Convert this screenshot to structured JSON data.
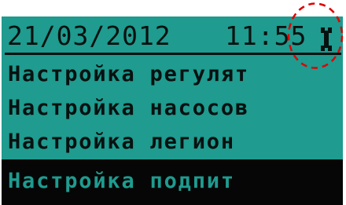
{
  "status_bar": {
    "date": "21/03/2012",
    "time": "11:55",
    "tool_icon": "wrench-icon"
  },
  "menu": {
    "items": [
      {
        "label": "Настройка регулят",
        "selected": false
      },
      {
        "label": "Настройка насосов",
        "selected": false
      },
      {
        "label": "Настройка легион",
        "selected": false
      },
      {
        "label": "Настройка подпит",
        "selected": true
      }
    ]
  },
  "annotation": {
    "shape": "dashed-circle",
    "color": "#e00000",
    "target": "wrench-icon"
  }
}
